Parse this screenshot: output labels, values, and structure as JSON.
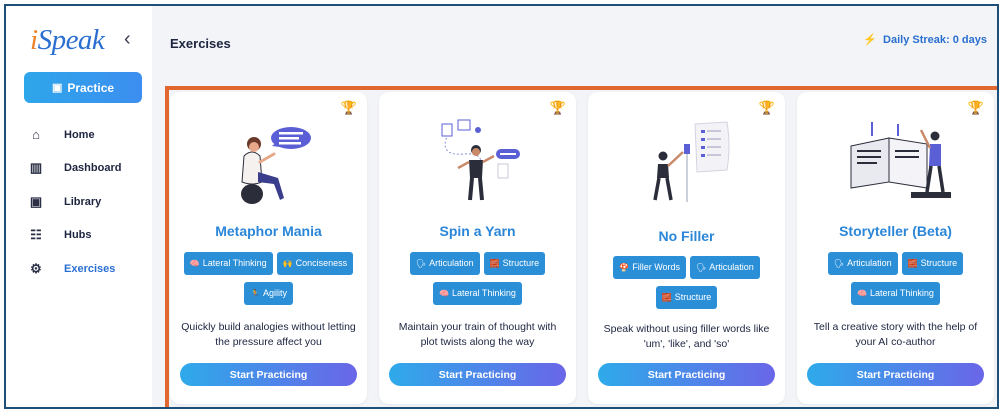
{
  "app": {
    "logo_text": "iSpeak",
    "collapse_icon": "chevron-left-icon"
  },
  "sidebar": {
    "practice_label": "Practice",
    "items": [
      {
        "label": "Home",
        "icon": "home-icon",
        "glyph": "⌂",
        "active": false
      },
      {
        "label": "Dashboard",
        "icon": "dashboard-icon",
        "glyph": "▥",
        "active": false
      },
      {
        "label": "Library",
        "icon": "library-icon",
        "glyph": "▣",
        "active": false
      },
      {
        "label": "Hubs",
        "icon": "hubs-icon",
        "glyph": "☷",
        "active": false
      },
      {
        "label": "Exercises",
        "icon": "exercises-icon",
        "glyph": "⚙",
        "active": true
      }
    ]
  },
  "header": {
    "title": "Exercises",
    "streak_label": "Daily Streak: 0 days"
  },
  "colors": {
    "brand_blue": "#2a86d8",
    "highlight_orange": "#e2672f",
    "tag_blue": "#2b8fd8"
  },
  "cards": [
    {
      "title": "Metaphor Mania",
      "tags": [
        {
          "emoji": "🧠",
          "label": "Lateral Thinking"
        },
        {
          "emoji": "🙌",
          "label": "Conciseness"
        },
        {
          "emoji": "🏃",
          "label": "Agility"
        }
      ],
      "desc": "Quickly build analogies without letting the pressure affect you",
      "button": "Start Practicing"
    },
    {
      "title": "Spin a Yarn",
      "tags": [
        {
          "emoji": "🗣",
          "label": "Articulation"
        },
        {
          "emoji": "🧱",
          "label": "Structure"
        },
        {
          "emoji": "🧠",
          "label": "Lateral Thinking"
        }
      ],
      "desc": "Maintain your train of thought with plot twists along the way",
      "button": "Start Practicing"
    },
    {
      "title": "No Filler",
      "tags": [
        {
          "emoji": "🍄",
          "label": "Filler Words"
        },
        {
          "emoji": "🗣",
          "label": "Articulation"
        },
        {
          "emoji": "🧱",
          "label": "Structure"
        }
      ],
      "desc": "Speak without using filler words like 'um', 'like', and 'so'",
      "button": "Start Practicing"
    },
    {
      "title": "Storyteller (Beta)",
      "tags": [
        {
          "emoji": "🗣",
          "label": "Articulation"
        },
        {
          "emoji": "🧱",
          "label": "Structure"
        },
        {
          "emoji": "🧠",
          "label": "Lateral Thinking"
        }
      ],
      "desc": "Tell a creative story with the help of your AI co-author",
      "button": "Start Practicing"
    }
  ]
}
